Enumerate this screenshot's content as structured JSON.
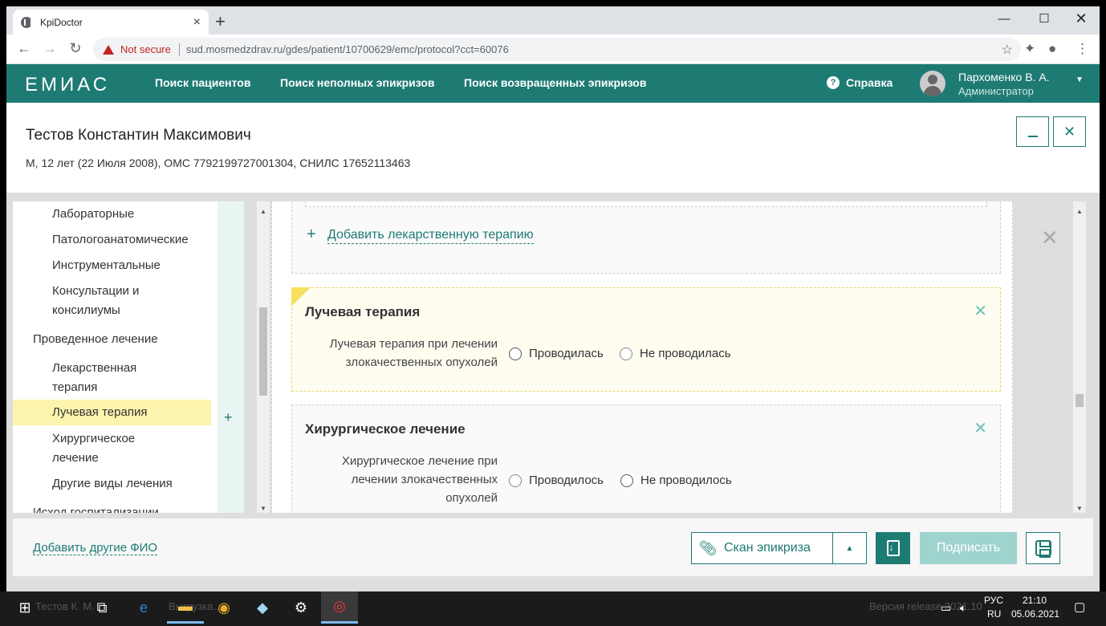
{
  "browser": {
    "tab_title": "KpiDoctor",
    "not_secure": "Not secure",
    "url": "sud.mosmedzdrav.ru/gdes/patient/10700629/emc/protocol?cct=60076"
  },
  "app": {
    "logo": "ЕМИАС",
    "nav": [
      "Поиск пациентов",
      "Поиск неполных эпикризов",
      "Поиск возвращенных эпикризов"
    ],
    "help": "Справка",
    "user_name": "Пархоменко В. А.",
    "user_role": "Администратор"
  },
  "patient": {
    "name": "Тестов Константин Максимович",
    "info": "М, 12 лет (22 Июля 2008), ОМС 7792199727001304, СНИЛС 17652113463"
  },
  "sidebar": {
    "items": [
      "Лабораторные",
      "Патологоанатомические",
      "Инструментальные",
      "Консультации и консилиумы",
      "Проведенное лечение",
      "Лекарственная терапия",
      "Лучевая терапия",
      "Хирургическое лечение",
      "Другие виды лечения",
      "Исход госпитализации"
    ],
    "active": "Лучевая терапия"
  },
  "main": {
    "add_drug_therapy": "Добавить лекарственную терапию",
    "radiation": {
      "title": "Лучевая терапия",
      "question": "Лучевая терапия при лечении злокачественных опухолей",
      "opt_yes": "Проводилась",
      "opt_no": "Не проводилась"
    },
    "surgery": {
      "title": "Хирургическое лечение",
      "question": "Хирургическое лечение при лечении злокачественных опухолей",
      "opt_yes": "Проводилось",
      "opt_no": "Не проводилось"
    }
  },
  "footer": {
    "add_fio": "Добавить другие ФИО",
    "scan": "Скан эпикриза",
    "sign": "Подписать"
  },
  "taskbar": {
    "lang": "РУС",
    "locale": "RU",
    "time": "21:10",
    "date": "05.06.2021",
    "ghost_left": "Тестов К. М.",
    "ghost_mid": "Выгрузка...",
    "ghost_right": "Версия release 2021.10"
  },
  "colors": {
    "brand": "#1e7b74",
    "highlight": "#fcf3ad"
  }
}
